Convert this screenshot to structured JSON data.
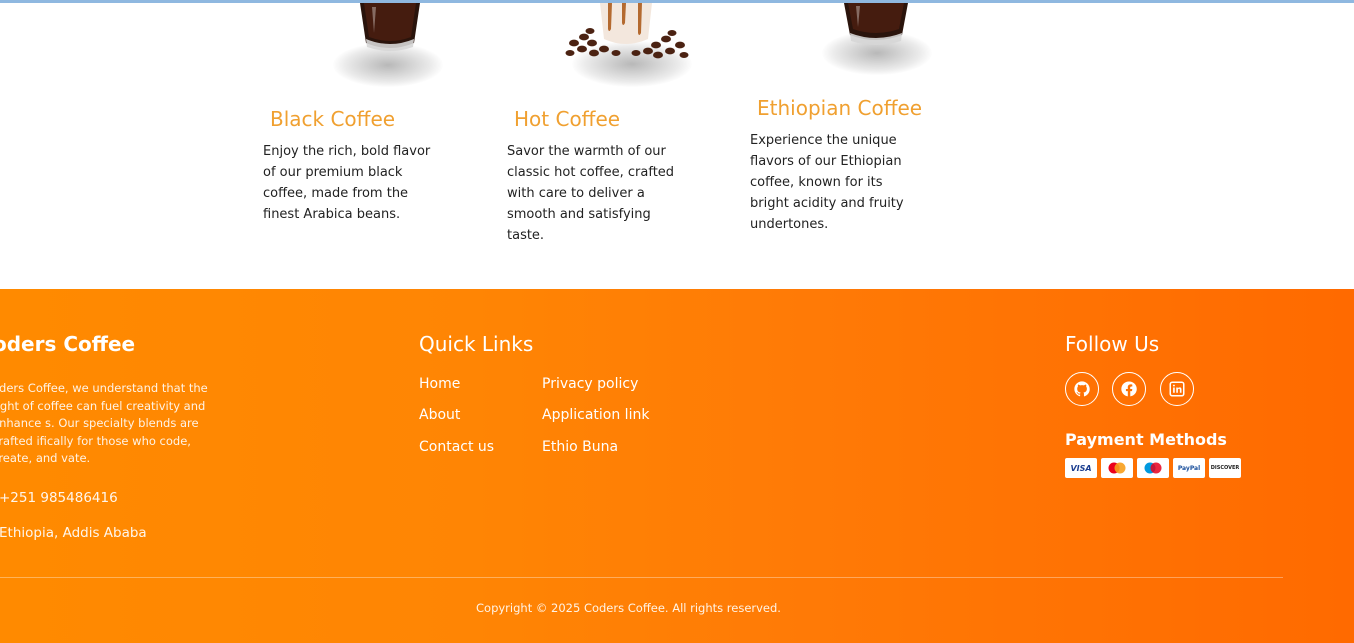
{
  "products": [
    {
      "title": "Black Coffee",
      "description": "Enjoy the rich, bold flavor of our premium black coffee, made from the finest Arabica beans."
    },
    {
      "title": "Hot Coffee",
      "description": "Savor the warmth of our classic hot coffee, crafted with care to deliver a smooth and satisfying taste."
    },
    {
      "title": "Ethiopian Coffee",
      "description": "Experience the unique flavors of our Ethiopian coffee, known for its bright acidity and fruity undertones."
    }
  ],
  "footer": {
    "brand_title": "oders Coffee",
    "about_text": "oders Coffee, we understand that the right of coffee can fuel creativity and enhance s. Our specialty blends are crafted ifically for those who code, create, and vate.",
    "phone": "+251 985486416",
    "location": "Ethiopia, Addis Ababa",
    "quick_links_title": "Quick Links",
    "links_col1": [
      "Home",
      "About",
      "Contact us"
    ],
    "links_col2": [
      "Privacy policy",
      "Application link",
      "Ethio Buna"
    ],
    "follow_title": "Follow Us",
    "social_icons": [
      "github-icon",
      "facebook-icon",
      "linkedin-icon"
    ],
    "payment_title": "Payment Methods",
    "payment_cards": [
      "VISA",
      "mastercard",
      "Maestro",
      "PayPal",
      "DISCOVER"
    ],
    "copyright": "Copyright © 2025 Coders Coffee. All rights reserved."
  },
  "colors": {
    "accent": "#f0a030",
    "footer_start": "#ff8a00",
    "footer_end": "#ff6a00"
  }
}
